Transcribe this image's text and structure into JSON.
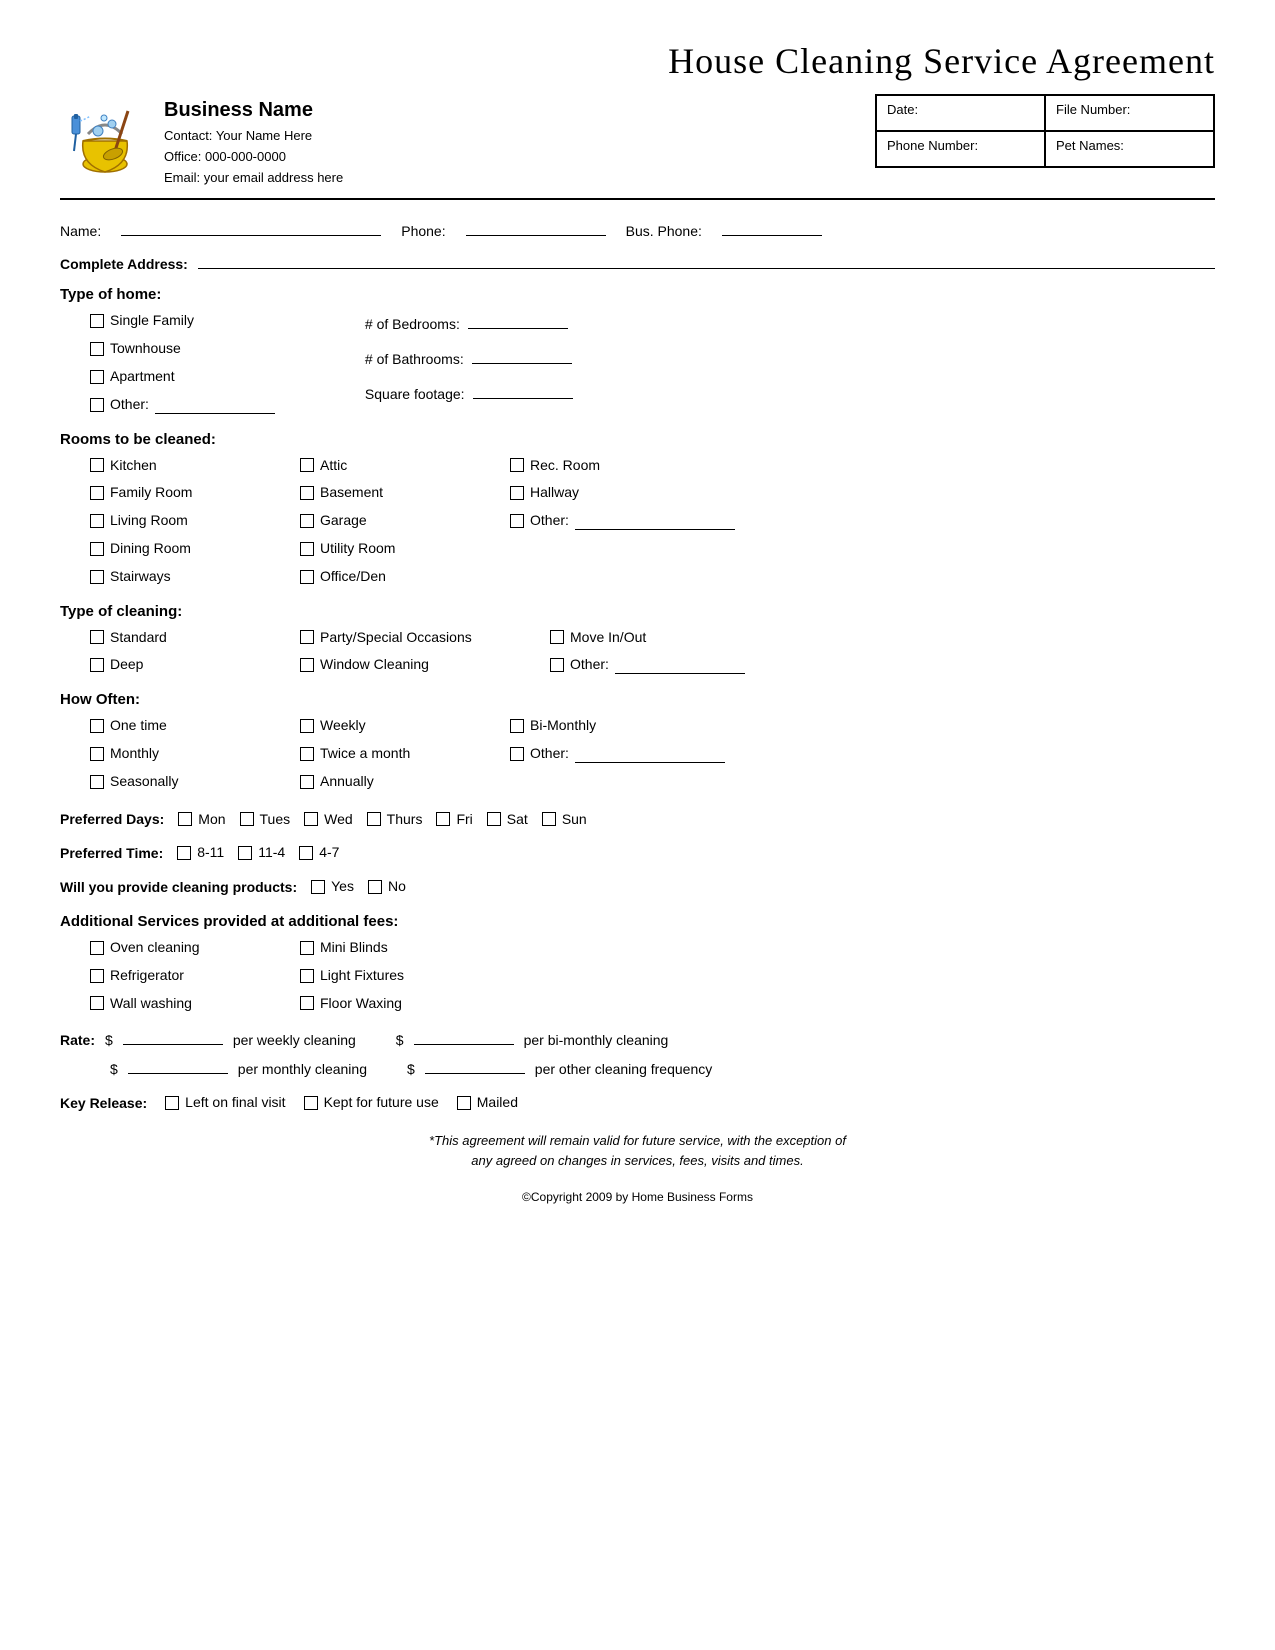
{
  "title": "House Cleaning Service Agreement",
  "business": {
    "name": "Business Name",
    "contact_label": "Contact:",
    "contact_value": "Your Name Here",
    "office_label": "Office:",
    "office_value": "000-000-0000",
    "email_label": "Email:",
    "email_value": "your email address here"
  },
  "header_fields": {
    "date_label": "Date:",
    "file_label": "File Number:",
    "phone_label": "Phone Number:",
    "pet_label": "Pet Names:"
  },
  "form": {
    "name_label": "Name:",
    "phone_label": "Phone:",
    "bus_phone_label": "Bus. Phone:",
    "address_label": "Complete Address:"
  },
  "type_of_home": {
    "title": "Type of home:",
    "options": [
      "Single Family",
      "Townhouse",
      "Apartment",
      "Other:________________"
    ],
    "fields": [
      "# of Bedrooms:",
      "# of Bathrooms:",
      "Square footage:"
    ]
  },
  "rooms": {
    "title": "Rooms to be cleaned:",
    "col1": [
      "Kitchen",
      "Family Room",
      "Living Room",
      "Dining Room",
      "Stairways"
    ],
    "col2": [
      "Attic",
      "Basement",
      "Garage",
      "Utility Room",
      "Office/Den"
    ],
    "col3": [
      "Rec. Room",
      "Hallway",
      "Other:___________________________"
    ]
  },
  "type_of_cleaning": {
    "title": "Type of cleaning:",
    "col1": [
      "Standard",
      "Deep"
    ],
    "col2": [
      "Party/Special Occasions",
      "Window Cleaning"
    ],
    "col3": [
      "Move In/Out",
      "Other:___________________"
    ]
  },
  "how_often": {
    "title": "How Often:",
    "col1": [
      "One time",
      "Monthly",
      "Seasonally"
    ],
    "col2": [
      "Weekly",
      "Twice a month",
      "Annually"
    ],
    "col3": [
      "Bi-Monthly",
      "Other: ____________________"
    ]
  },
  "preferred_days": {
    "label": "Preferred Days:",
    "days": [
      "Mon",
      "Tues",
      "Wed",
      "Thurs",
      "Fri",
      "Sat",
      "Sun"
    ]
  },
  "preferred_time": {
    "label": "Preferred Time:",
    "times": [
      "8-11",
      "11-4",
      "4-7"
    ]
  },
  "cleaning_products": {
    "label": "Will you provide cleaning products:",
    "options": [
      "Yes",
      "No"
    ]
  },
  "additional_services": {
    "title": "Additional Services provided at additional fees:",
    "col1": [
      "Oven cleaning",
      "Refrigerator",
      "Wall washing"
    ],
    "col2": [
      "Mini Blinds",
      "Light Fixtures",
      "Floor Waxing"
    ]
  },
  "rate": {
    "label": "Rate:",
    "dollar": "$",
    "per_weekly": "per weekly cleaning",
    "per_bimonthly": "per bi-monthly cleaning",
    "per_monthly": "per monthly cleaning",
    "per_other": "per other cleaning frequency"
  },
  "key_release": {
    "label": "Key Release:",
    "options": [
      "Left on final visit",
      "Kept for future use",
      "Mailed"
    ]
  },
  "footer": {
    "note_line1": "*This agreement will remain valid for future service, with the exception of",
    "note_line2": "any agreed on changes in services, fees, visits and times.",
    "copyright": "©Copyright 2009 by Home Business Forms"
  }
}
